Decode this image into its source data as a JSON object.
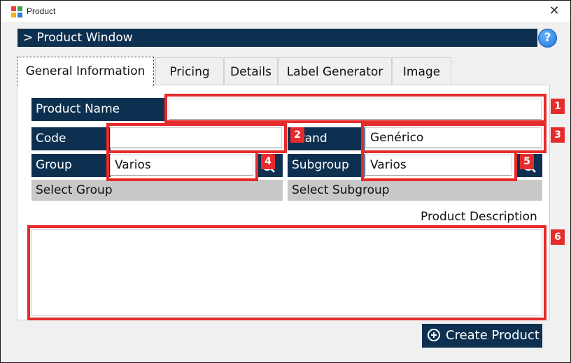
{
  "window": {
    "title": "Product",
    "close_glyph": "✕"
  },
  "header": {
    "title": "> Product Window",
    "help_glyph": "?"
  },
  "tabs": [
    {
      "label": "General Information",
      "active": true
    },
    {
      "label": "Pricing"
    },
    {
      "label": "Details"
    },
    {
      "label": "Label Generator"
    },
    {
      "label": "Image"
    }
  ],
  "form": {
    "product_name": {
      "label": "Product Name",
      "value": ""
    },
    "code": {
      "label": "Code",
      "value": ""
    },
    "brand": {
      "label": "Brand",
      "value": "Genérico"
    },
    "group": {
      "label": "Group",
      "value": "Varios",
      "select_label": "Select Group"
    },
    "subgroup": {
      "label": "Subgroup",
      "value": "Varios",
      "select_label": "Select Subgroup"
    },
    "description": {
      "label": "Product Description",
      "value": ""
    }
  },
  "annotations": [
    "1",
    "2",
    "3",
    "4",
    "5",
    "6"
  ],
  "actions": {
    "create_label": "Create Product"
  },
  "colors": {
    "navy": "#0e3050",
    "highlight": "#e52b2b",
    "select_bar": "#c8c8c8"
  },
  "icons": {
    "app": "app-logo-icon",
    "close": "close-icon",
    "help": "help-icon",
    "search": "search-icon",
    "plus": "plus-circle-icon"
  }
}
